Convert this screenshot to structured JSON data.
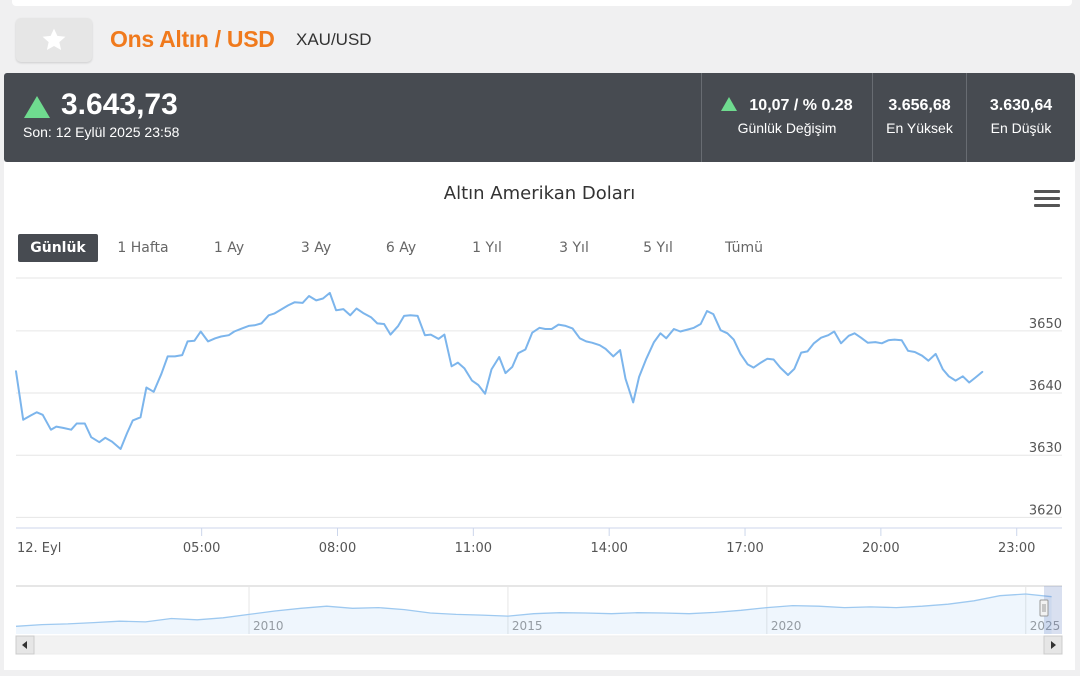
{
  "header": {
    "title": "Ons Altın / USD",
    "symbol": "XAU/USD",
    "favorite_icon": "star-icon"
  },
  "quote": {
    "price": "3.643,73",
    "last_update": "Son: 12 Eylül 2025 23:58",
    "direction": "up",
    "change": "10,07 / % 0.28",
    "change_label": "Günlük Değişim",
    "high": "3.656,68",
    "high_label": "En Yüksek",
    "low": "3.630,64",
    "low_label": "En Düşük",
    "up_color": "#6fdb8f"
  },
  "chart": {
    "title": "Altın Amerikan Doları",
    "menu_icon": "hamburger-menu-icon",
    "ranges": [
      "Günlük",
      "1 Hafta",
      "1 Ay",
      "3 Ay",
      "6 Ay",
      "1 Yıl",
      "3 Yıl",
      "5 Yıl",
      "Tümü"
    ],
    "active_range": "Günlük"
  },
  "chart_data": {
    "type": "line",
    "title": "Altın Amerikan Doları",
    "line_color": "#7cb5ec",
    "x_tick_labels": [
      "12. Eyl",
      "05:00",
      "08:00",
      "11:00",
      "14:00",
      "17:00",
      "20:00",
      "23:00"
    ],
    "x_ticks_hours": [
      0,
      5,
      8,
      11,
      14,
      17,
      20,
      23
    ],
    "xlim_hours": [
      0.9,
      24
    ],
    "y_tick_labels": [
      "3620",
      "3630",
      "3640",
      "3650"
    ],
    "y_ticks": [
      3620,
      3630,
      3640,
      3650
    ],
    "ylim": [
      3618.3,
      3658.5
    ],
    "grid": true,
    "series": [
      {
        "x_hours": [
          0.9,
          1.06,
          1.23,
          1.36,
          1.49,
          1.67,
          1.79,
          1.94,
          2.12,
          2.24,
          2.42,
          2.56,
          2.74,
          2.87,
          3.02,
          3.21,
          3.35,
          3.48,
          3.65,
          3.78,
          3.94,
          4.11,
          4.25,
          4.41,
          4.57,
          4.69,
          4.84,
          4.98,
          5.14,
          5.3,
          5.43,
          5.6,
          5.72,
          5.89,
          6.04,
          6.17,
          6.32,
          6.48,
          6.61,
          6.77,
          6.91,
          7.05,
          7.23,
          7.37,
          7.53,
          7.68,
          7.83,
          7.97,
          8.13,
          8.28,
          8.42,
          8.58,
          8.74,
          8.88,
          9.03,
          9.17,
          9.34,
          9.47,
          9.61,
          9.77,
          9.93,
          10.06,
          10.23,
          10.36,
          10.52,
          10.66,
          10.8,
          10.97,
          11.11,
          11.26,
          11.4,
          11.57,
          11.71,
          11.86,
          11.99,
          12.15,
          12.3,
          12.46,
          12.59,
          12.73,
          12.88,
          13.04,
          13.19,
          13.35,
          13.49,
          13.62,
          13.79,
          13.92,
          14.09,
          14.24,
          14.36,
          14.53,
          14.66,
          14.82,
          14.99,
          15.13,
          15.26,
          15.43,
          15.57,
          15.73,
          15.87,
          16.02,
          16.16,
          16.3,
          16.46,
          16.61,
          16.75,
          16.9,
          17.06,
          17.19,
          17.35,
          17.49,
          17.63,
          17.78,
          17.95,
          18.09,
          18.24,
          18.38,
          18.52,
          18.68,
          18.84,
          18.97,
          19.12,
          19.29,
          19.42,
          19.56,
          19.71,
          19.88,
          20.02,
          20.17,
          20.3,
          20.46,
          20.6,
          20.75,
          20.91,
          21.05,
          21.21,
          21.37,
          21.5,
          21.65,
          21.81,
          21.95,
          22.09,
          22.24,
          22.4,
          22.53,
          22.69,
          22.84,
          22.98,
          23.13,
          23.29,
          23.43,
          23.58,
          23.71,
          23.87,
          24.0
        ],
        "y": [
          3643.5,
          3635.7,
          3636.4,
          3636.9,
          3636.5,
          3634.1,
          3634.6,
          3634.4,
          3634.1,
          3635.1,
          3635.1,
          3632.9,
          3632.1,
          3632.8,
          3632.2,
          3631.0,
          3633.5,
          3635.6,
          3636.1,
          3640.9,
          3640.2,
          3643.1,
          3645.9,
          3645.9,
          3646.1,
          3648.3,
          3648.4,
          3649.9,
          3648.3,
          3648.8,
          3649.1,
          3649.3,
          3649.9,
          3650.4,
          3650.8,
          3650.9,
          3651.2,
          3652.5,
          3652.8,
          3653.5,
          3654.1,
          3654.6,
          3654.5,
          3655.6,
          3654.9,
          3655.2,
          3656.1,
          3653.3,
          3653.5,
          3652.5,
          3653.6,
          3652.8,
          3652.2,
          3651.2,
          3651.1,
          3649.4,
          3650.8,
          3652.4,
          3652.5,
          3652.4,
          3649.3,
          3649.4,
          3648.7,
          3649.4,
          3644.3,
          3644.9,
          3644.0,
          3642.0,
          3641.3,
          3639.9,
          3643.8,
          3645.8,
          3643.2,
          3644.2,
          3646.4,
          3647.0,
          3649.7,
          3650.5,
          3650.3,
          3650.3,
          3651.0,
          3650.8,
          3650.4,
          3648.8,
          3648.3,
          3648.1,
          3647.7,
          3647.1,
          3645.9,
          3646.9,
          3642.3,
          3638.5,
          3642.6,
          3645.5,
          3648.2,
          3649.6,
          3648.8,
          3650.3,
          3649.9,
          3650.2,
          3650.5,
          3651.1,
          3653.2,
          3652.7,
          3650.1,
          3649.6,
          3648.6,
          3646.3,
          3644.6,
          3644.1,
          3644.9,
          3645.5,
          3645.4,
          3644.1,
          3642.9,
          3643.9,
          3646.5,
          3646.7,
          3648.0,
          3648.9,
          3649.3,
          3649.9,
          3648.0,
          3649.2,
          3649.6,
          3648.9,
          3648.1,
          3648.2,
          3648.0,
          3648.5,
          3648.6,
          3648.5,
          3646.8,
          3646.6,
          3646.0,
          3645.2,
          3646.3,
          3643.8,
          3642.7,
          3642.0,
          3642.7,
          3641.7,
          3642.5,
          3643.4
        ]
      }
    ],
    "navigator": {
      "x_tick_labels": [
        "2010",
        "2015",
        "2020",
        "2025"
      ],
      "x_ticks_years": [
        2010,
        2015,
        2020,
        2025
      ],
      "xlim_years": [
        2005.5,
        2025.7
      ],
      "ylim": [
        0,
        100
      ],
      "x_years": [
        2005.5,
        2006,
        2006.5,
        2007,
        2007.5,
        2008,
        2008.5,
        2009,
        2009.5,
        2010,
        2010.5,
        2011,
        2011.5,
        2012,
        2012.5,
        2013,
        2013.5,
        2014,
        2014.5,
        2015,
        2015.5,
        2016,
        2016.5,
        2017,
        2017.5,
        2018,
        2018.5,
        2019,
        2019.5,
        2020,
        2020.5,
        2021,
        2021.5,
        2022,
        2022.5,
        2023,
        2023.5,
        2024,
        2024.5,
        2025,
        2025.5
      ],
      "y": [
        5,
        10,
        12,
        16,
        20,
        18,
        28,
        24,
        30,
        40,
        50,
        58,
        64,
        58,
        60,
        54,
        44,
        40,
        38,
        35,
        42,
        45,
        44,
        42,
        45,
        44,
        42,
        46,
        52,
        60,
        66,
        64,
        60,
        62,
        60,
        64,
        70,
        80,
        95,
        100,
        92
      ]
    }
  }
}
